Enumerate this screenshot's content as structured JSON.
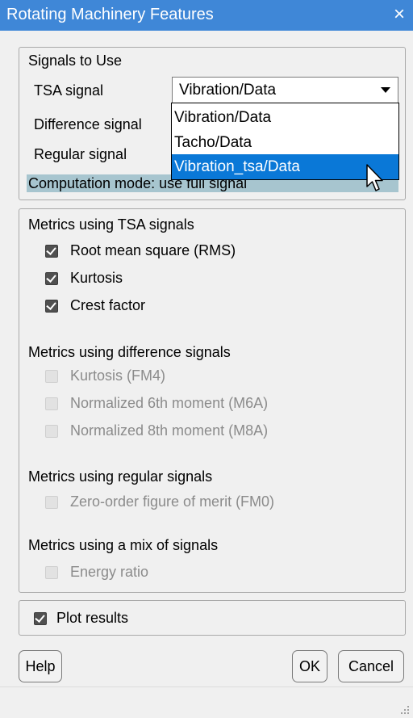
{
  "window": {
    "title": "Rotating Machinery Features",
    "close_glyph": "×"
  },
  "signals": {
    "group_label": "Signals to Use",
    "tsa_label": "TSA signal",
    "difference_label": "Difference signal",
    "regular_label": "Regular signal",
    "tsa_selected": "Vibration/Data",
    "dropdown_options": [
      "Vibration/Data",
      "Tacho/Data",
      "Vibration_tsa/Data"
    ],
    "highlighted_option_index": 2,
    "computation_mode": "Computation mode: use full signal"
  },
  "metrics": {
    "tsa_group": "Metrics using TSA signals",
    "tsa_items": [
      {
        "label": "Root mean square (RMS)",
        "checked": true,
        "enabled": true
      },
      {
        "label": "Kurtosis",
        "checked": true,
        "enabled": true
      },
      {
        "label": "Crest factor",
        "checked": true,
        "enabled": true
      }
    ],
    "difference_group": "Metrics using difference signals",
    "difference_items": [
      {
        "label": "Kurtosis (FM4)",
        "checked": false,
        "enabled": false
      },
      {
        "label": "Normalized 6th moment (M6A)",
        "checked": false,
        "enabled": false
      },
      {
        "label": "Normalized 8th moment (M8A)",
        "checked": false,
        "enabled": false
      }
    ],
    "regular_group": "Metrics using regular signals",
    "regular_items": [
      {
        "label": "Zero-order figure of merit (FM0)",
        "checked": false,
        "enabled": false
      }
    ],
    "mix_group": "Metrics using a mix of signals",
    "mix_items": [
      {
        "label": "Energy ratio",
        "checked": false,
        "enabled": false
      }
    ]
  },
  "plot": {
    "label": "Plot results",
    "checked": true
  },
  "buttons": {
    "help": "Help",
    "ok": "OK",
    "cancel": "Cancel"
  },
  "colors": {
    "titlebar": "#3f87d7",
    "selection": "#0a78d7",
    "mode_bar": "#a7c5cf"
  }
}
